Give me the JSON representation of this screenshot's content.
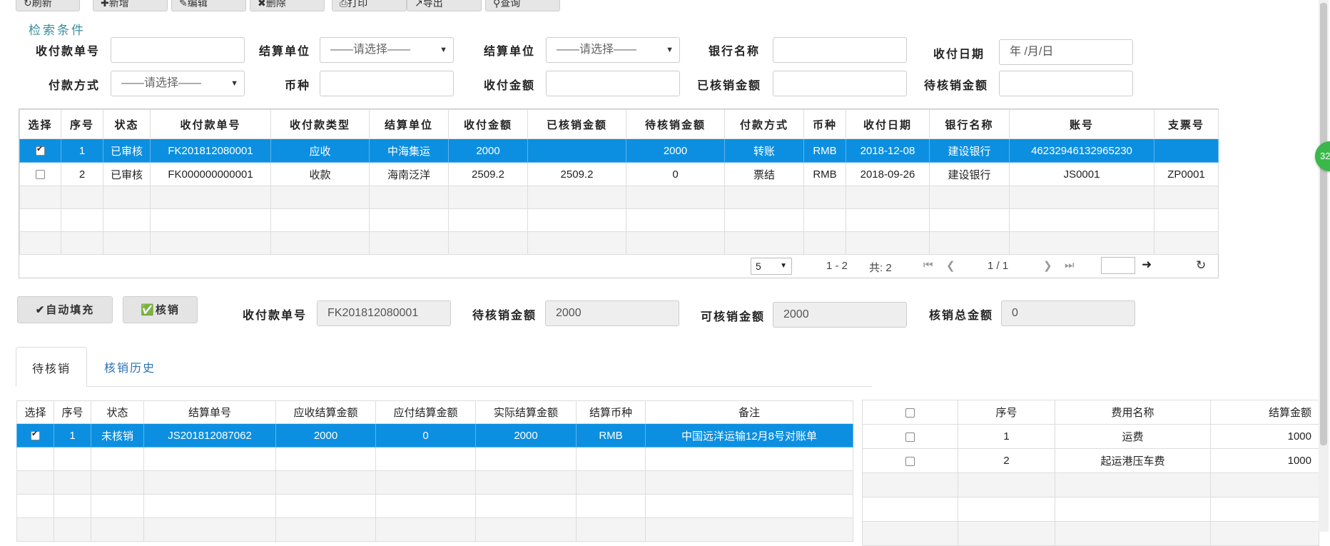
{
  "toolbar": [
    "刷新",
    "新增",
    "编辑",
    "删除",
    "打印",
    "导出",
    "查询"
  ],
  "search": {
    "title": "检索条件",
    "labels": {
      "receipt_no": "收付款单号",
      "settle_unit1": "结算单位",
      "settle_unit2": "结算单位",
      "bank_name": "银行名称",
      "pay_date": "收付日期",
      "pay_method": "付款方式",
      "currency": "币种",
      "amount": "收付金额",
      "written_off": "已核销金额",
      "pending": "待核销金额"
    },
    "select_placeholder": "——请选择——",
    "date_placeholder": "年 /月/日"
  },
  "main_table": {
    "headers": [
      "选择",
      "序号",
      "状态",
      "收付款单号",
      "收付款类型",
      "结算单位",
      "收付金额",
      "已核销金额",
      "待核销金额",
      "付款方式",
      "币种",
      "收付日期",
      "银行名称",
      "账号",
      "支票号"
    ],
    "rows": [
      {
        "checked": true,
        "seq": "1",
        "status": "已审核",
        "no": "FK201812080001",
        "type": "应收",
        "unit": "中海集运",
        "amount": "2000",
        "written": "",
        "pending": "2000",
        "method": "转账",
        "cur": "RMB",
        "date": "2018-12-08",
        "bank": "建设银行",
        "account": "46232946132965230",
        "cheque": ""
      },
      {
        "checked": false,
        "seq": "2",
        "status": "已审核",
        "no": "FK000000000001",
        "type": "收款",
        "unit": "海南泛洋",
        "amount": "2509.2",
        "written": "2509.2",
        "pending": "0",
        "method": "票结",
        "cur": "RMB",
        "date": "2018-09-26",
        "bank": "建设银行",
        "account": "JS0001",
        "cheque": "ZP0001"
      }
    ]
  },
  "pager": {
    "size": "5",
    "range": "1 - 2",
    "total": "共: 2",
    "pages": "1 / 1"
  },
  "actions": {
    "auto_fill": "自动填充",
    "verify": "核销",
    "receipt_no_label": "收付款单号",
    "receipt_no_value": "FK201812080001",
    "pending_label": "待核销金额",
    "pending_value": "2000",
    "available_label": "可核销金额",
    "available_value": "2000",
    "total_label": "核销总金额",
    "total_value": "0"
  },
  "tabs": {
    "active": "待核销",
    "history": "核销历史"
  },
  "bottom_table": {
    "headers": [
      "选择",
      "序号",
      "状态",
      "结算单号",
      "应收结算金额",
      "应付结算金额",
      "实际结算金额",
      "结算币种",
      "备注"
    ],
    "row": {
      "checked": true,
      "seq": "1",
      "status": "未核销",
      "no": "JS201812087062",
      "recv": "2000",
      "pay": "0",
      "actual": "2000",
      "cur": "RMB",
      "note": "中国远洋运输12月8号对账单"
    }
  },
  "fee_table": {
    "headers": [
      "序号",
      "费用名称",
      "结算金额"
    ],
    "rows": [
      {
        "seq": "1",
        "name": "运费",
        "amount": "1000"
      },
      {
        "seq": "2",
        "name": "起运港压车费",
        "amount": "1000"
      }
    ]
  },
  "side_badge": "32"
}
